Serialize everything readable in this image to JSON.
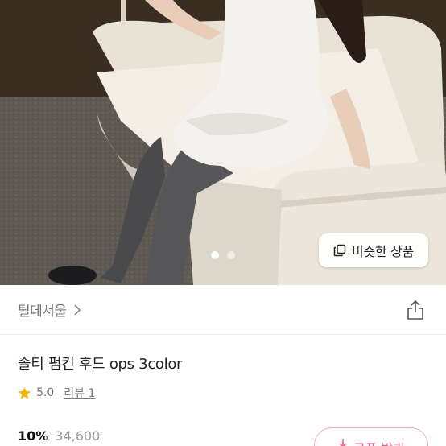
{
  "photo": {
    "similar_button_label": "비슷한 상품",
    "slides_total": 2,
    "slide_active": 1
  },
  "shop": {
    "name": "틸데서울"
  },
  "product": {
    "title": "솔티 펌킨 후드 ops 3color",
    "rating": "5.0",
    "reviews_label": "리뷰 1",
    "discount": "10%",
    "original_price": "34,600"
  },
  "coupon": {
    "label": "쿠폰 받기"
  },
  "colors": {
    "accent": "#ef5b8f",
    "accent_border": "#f4a6c6",
    "star": "#f5b400"
  },
  "icons": [
    "copy-icon",
    "chevron-right-icon",
    "share-icon",
    "star-icon",
    "download-icon"
  ]
}
